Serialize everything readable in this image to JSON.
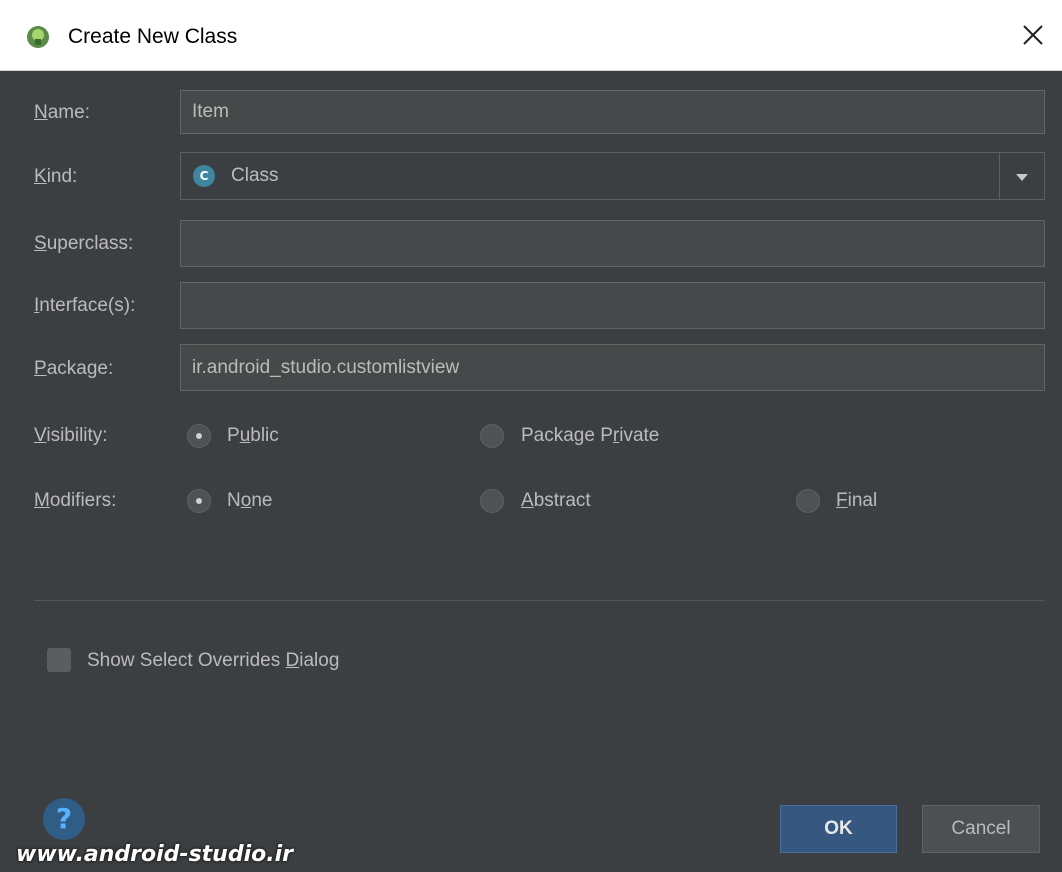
{
  "dialog": {
    "title": "Create New Class",
    "close_icon": "close-icon"
  },
  "fields": {
    "name": {
      "label_prefix": "",
      "label_mnemonic": "N",
      "label_rest": "ame:",
      "value": "Item"
    },
    "kind": {
      "label_prefix": "",
      "label_mnemonic": "K",
      "label_rest": "ind:",
      "value": "Class",
      "icon_letter": "C"
    },
    "superclass": {
      "label_prefix": "",
      "label_mnemonic": "S",
      "label_rest": "uperclass:",
      "value": ""
    },
    "interfaces": {
      "label_prefix": "",
      "label_mnemonic": "I",
      "label_rest": "nterface(s):",
      "value": ""
    },
    "package": {
      "label_prefix": "",
      "label_mnemonic": "P",
      "label_rest": "ackage:",
      "value": "ir.android_studio.customlistview"
    }
  },
  "visibility": {
    "label_mnemonic": "V",
    "label_rest": "isibility:",
    "options": [
      {
        "pre": "P",
        "mn": "u",
        "post": "blic",
        "selected": true
      },
      {
        "pre": "Package P",
        "mn": "r",
        "post": "ivate",
        "selected": false
      }
    ]
  },
  "modifiers": {
    "label_mnemonic": "M",
    "label_rest": "odifiers:",
    "options": [
      {
        "pre": "N",
        "mn": "o",
        "post": "ne",
        "selected": true
      },
      {
        "pre": "",
        "mn": "A",
        "post": "bstract",
        "selected": false
      },
      {
        "pre": "",
        "mn": "F",
        "post": "inal",
        "selected": false
      }
    ]
  },
  "overrides_checkbox": {
    "pre": "Show Select Overrides ",
    "mn": "D",
    "post": "ialog",
    "checked": false
  },
  "buttons": {
    "ok": "OK",
    "cancel": "Cancel",
    "help": "?"
  },
  "watermark": "www.android-studio.ir",
  "colors": {
    "background": "#3c3f41",
    "ok_button": "#365880",
    "class_icon": "#3e86a0"
  }
}
